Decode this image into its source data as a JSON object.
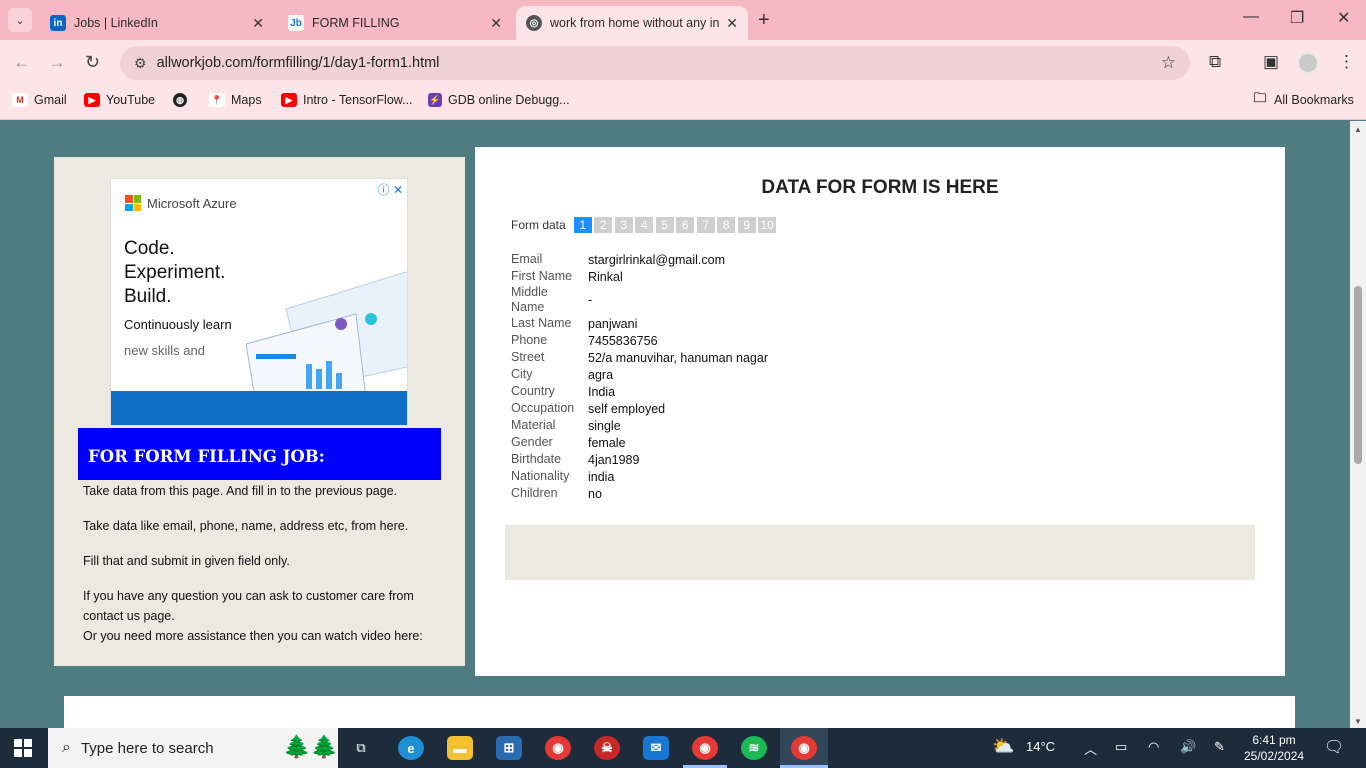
{
  "browser": {
    "tabs": [
      {
        "title": "Jobs | LinkedIn",
        "icon": "linkedin-icon",
        "color": "#0a66c2"
      },
      {
        "title": "FORM FILLING",
        "icon": "allworkjob-icon",
        "color": "#1a73e8"
      },
      {
        "title": "work from home without any in",
        "icon": "globe-icon",
        "color": "#555555"
      }
    ],
    "url": "allworkjob.com/formfilling/1/day1-form1.html",
    "bookmarks": [
      {
        "label": "Gmail",
        "icon": "gmail-icon",
        "color": "#d93025"
      },
      {
        "label": "YouTube",
        "icon": "youtube-icon",
        "color": "#ff0000"
      },
      {
        "label": "",
        "icon": "globe-icon",
        "color": "#222222"
      },
      {
        "label": "Maps",
        "icon": "maps-icon",
        "color": "#34a853"
      },
      {
        "label": "Intro - TensorFlow...",
        "icon": "youtube-icon",
        "color": "#ff0000"
      },
      {
        "label": "GDB online Debugg...",
        "icon": "gdb-icon",
        "color": "#6a3fb5"
      }
    ],
    "all_bookmarks": "All Bookmarks"
  },
  "ad": {
    "brand": "Microsoft Azure",
    "headline": [
      "Code.",
      "Experiment.",
      "Build."
    ],
    "sub1": "Continuously learn",
    "sub2": "new skills and"
  },
  "left": {
    "heading": "FOR FORM FILLING JOB:",
    "p1": "Take data from this page. And fill in to the previous page.",
    "p2": "Take data like email, phone, name, address etc, from here.",
    "p3": "Fill that and submit in given field only.",
    "p4": "If you have any question you can ask to customer care from contact us page.",
    "p5": "Or you need more assistance then you can watch video here:"
  },
  "main": {
    "title": "DATA FOR FORM IS HERE",
    "form_data_label": "Form data",
    "pages": [
      "1",
      "2",
      "3",
      "4",
      "5",
      "6",
      "7",
      "8",
      "9",
      "10"
    ],
    "active_page": "1",
    "fields": [
      {
        "key": "Email",
        "value": "stargirlrinkal@gmail.com"
      },
      {
        "key": "First Name",
        "value": "Rinkal"
      },
      {
        "key": "Middle Name",
        "value": "-"
      },
      {
        "key": "Last Name",
        "value": "panjwani"
      },
      {
        "key": "Phone",
        "value": "7455836756"
      },
      {
        "key": "Street",
        "value": "52/a manuvihar, hanuman nagar"
      },
      {
        "key": "City",
        "value": "agra"
      },
      {
        "key": "Country",
        "value": "India"
      },
      {
        "key": "Occupation",
        "value": "self employed"
      },
      {
        "key": "Material",
        "value": "single"
      },
      {
        "key": "Gender",
        "value": "female"
      },
      {
        "key": "Birthdate",
        "value": "4jan1989"
      },
      {
        "key": "Nationality",
        "value": "india"
      },
      {
        "key": "Children",
        "value": "no"
      }
    ]
  },
  "taskbar": {
    "search_placeholder": "Type here to search",
    "weather": "14°C",
    "time": "6:41 pm",
    "date": "25/02/2024"
  }
}
